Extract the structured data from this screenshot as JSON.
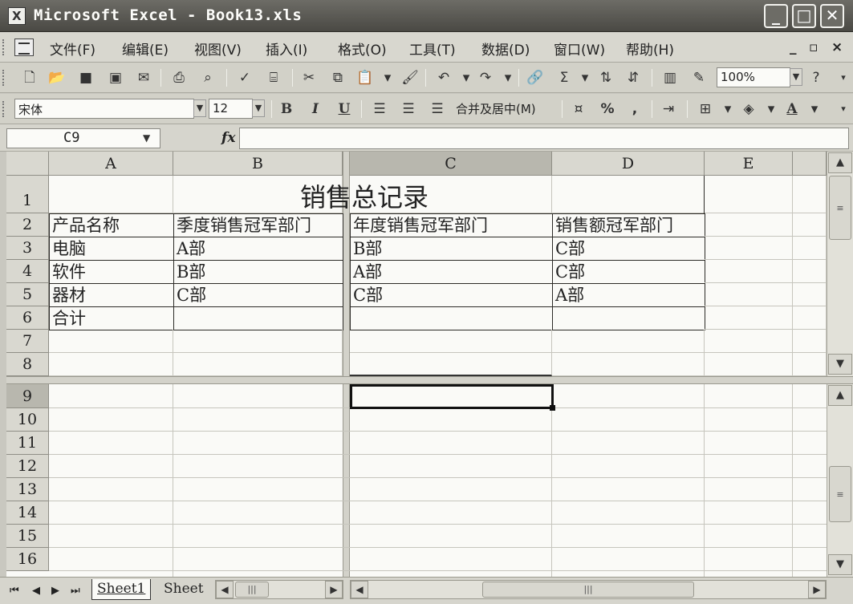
{
  "window": {
    "title": "Microsoft Excel - Book13.xls"
  },
  "menu": {
    "items": [
      "文件(F)",
      "编辑(E)",
      "视图(V)",
      "插入(I)",
      "格式(O)",
      "工具(T)",
      "数据(D)",
      "窗口(W)",
      "帮助(H)"
    ]
  },
  "toolbar": {
    "zoom": "100%",
    "sum_icon": "Σ",
    "sort_asc_icon": "sort-ascending-icon",
    "sort_desc_icon": "sort-descending-icon"
  },
  "format": {
    "font": "宋体",
    "size": "12",
    "bold": "B",
    "italic": "I",
    "underline": "U",
    "merge_center": "合并及居中(M)",
    "percent": "%",
    "comma": ",",
    "font_color": "A"
  },
  "formula": {
    "namebox": "C9",
    "fx": "fx",
    "value": ""
  },
  "columns": [
    "A",
    "B",
    "C",
    "D",
    "E"
  ],
  "rows_top": [
    "1",
    "2",
    "3",
    "4",
    "5",
    "6",
    "7",
    "8"
  ],
  "rows_bottom": [
    "9",
    "10",
    "11",
    "12",
    "13",
    "14",
    "15",
    "16"
  ],
  "cells": {
    "title": "销售总记录",
    "header": [
      "产品名称",
      "季度销售冠军部门",
      "年度销售冠军部门",
      "销售额冠军部门"
    ],
    "rows": [
      [
        "电脑",
        "A部",
        "B部",
        "C部"
      ],
      [
        "软件",
        "B部",
        "A部",
        "C部"
      ],
      [
        "器材",
        "C部",
        "C部",
        "A部"
      ],
      [
        "合计",
        "",
        "",
        ""
      ]
    ]
  },
  "sheets": [
    "Sheet1",
    "Sheet"
  ],
  "scroll": {
    "thumb": "≡",
    "hthumb": "|||"
  }
}
